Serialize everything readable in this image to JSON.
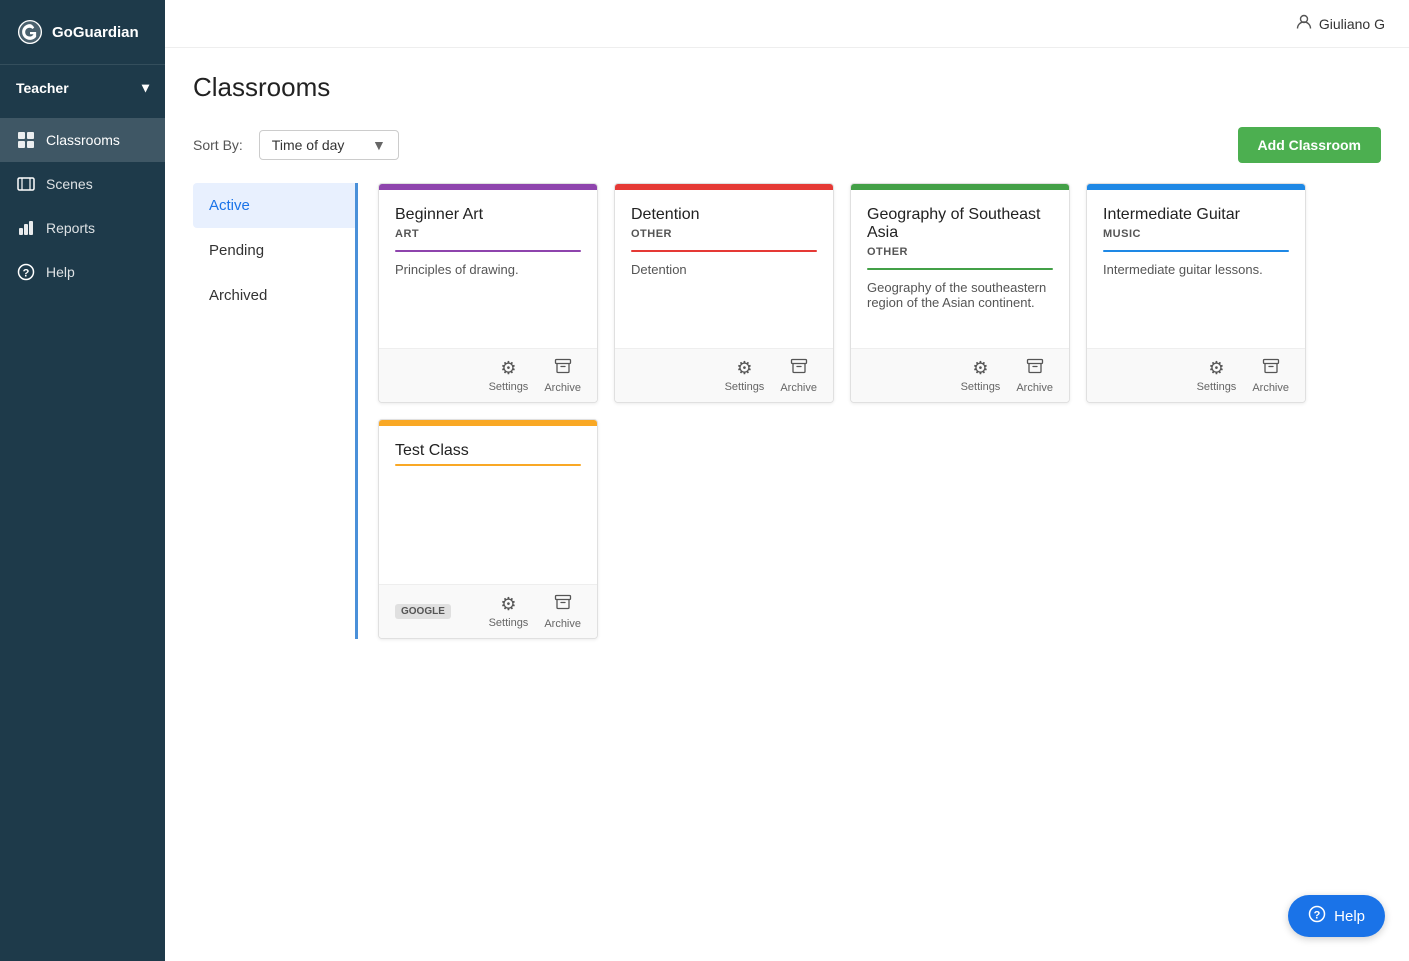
{
  "brand": {
    "name": "GoGuardian"
  },
  "topbar": {
    "user": "Giuliano G"
  },
  "sidebar": {
    "role": "Teacher",
    "items": [
      {
        "id": "classrooms",
        "label": "Classrooms",
        "icon": "grid",
        "active": true
      },
      {
        "id": "scenes",
        "label": "Scenes",
        "icon": "film",
        "active": false
      },
      {
        "id": "reports",
        "label": "Reports",
        "icon": "bar-chart",
        "active": false
      },
      {
        "id": "help",
        "label": "Help",
        "icon": "help-circle",
        "active": false
      }
    ]
  },
  "page": {
    "title": "Classrooms"
  },
  "filter": {
    "sort_label": "Sort By:",
    "sort_value": "Time of day",
    "add_button": "Add Classroom"
  },
  "left_nav": {
    "items": [
      {
        "id": "active",
        "label": "Active",
        "active": true
      },
      {
        "id": "pending",
        "label": "Pending",
        "active": false
      },
      {
        "id": "archived",
        "label": "Archived",
        "active": false
      }
    ]
  },
  "classrooms": [
    {
      "id": "beginner-art",
      "title": "Beginner Art",
      "subject": "Art",
      "description": "Principles of drawing.",
      "color": "#8e44ad",
      "google": false
    },
    {
      "id": "detention",
      "title": "Detention",
      "subject": "Other",
      "description": "Detention",
      "color": "#e53935",
      "google": false
    },
    {
      "id": "geography-southeast-asia",
      "title": "Geography of Southeast Asia",
      "subject": "Other",
      "description": "Geography of the southeastern region of the Asian continent.",
      "color": "#43a047",
      "google": false
    },
    {
      "id": "intermediate-guitar",
      "title": "Intermediate Guitar",
      "subject": "Music",
      "description": "Intermediate guitar lessons.",
      "color": "#1e88e5",
      "google": false
    },
    {
      "id": "test-class",
      "title": "Test Class",
      "subject": "",
      "description": "",
      "color": "#f9a825",
      "google": true
    }
  ],
  "card_actions": {
    "settings": "Settings",
    "archive": "Archive"
  },
  "help_fab": {
    "label": "Help"
  }
}
